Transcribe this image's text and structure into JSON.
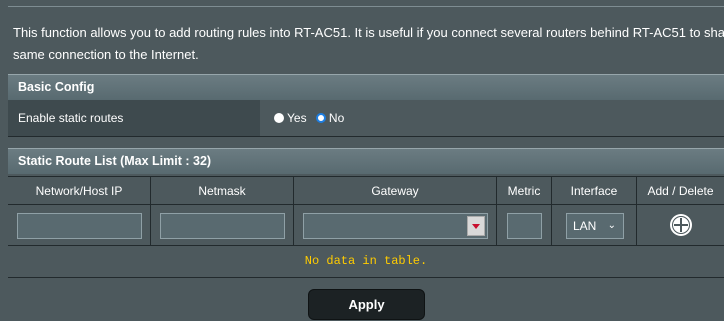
{
  "description": {
    "line1": "This function allows you to add routing rules into RT-AC51. It is useful if you connect several routers behind RT-AC51 to share the",
    "line2": "same connection to the Internet."
  },
  "basic_config": {
    "title": "Basic Config",
    "enable_label": "Enable static routes",
    "options": [
      {
        "label": "Yes",
        "selected": false
      },
      {
        "label": "No",
        "selected": true
      }
    ]
  },
  "route_list": {
    "title": "Static Route List (Max Limit : 32)",
    "columns": [
      "Network/Host IP",
      "Netmask",
      "Gateway",
      "Metric",
      "Interface",
      "Add / Delete"
    ],
    "inputs": {
      "network_ip": "",
      "netmask": "",
      "gateway": "",
      "metric": "",
      "interface": "LAN"
    },
    "empty_message": "No data in table."
  },
  "apply_label": "Apply",
  "colors": {
    "background": "#4d595d",
    "header_bar": "#5f7076",
    "empty_text": "#ffcc00",
    "radio_selected": "#1d7ee2"
  }
}
